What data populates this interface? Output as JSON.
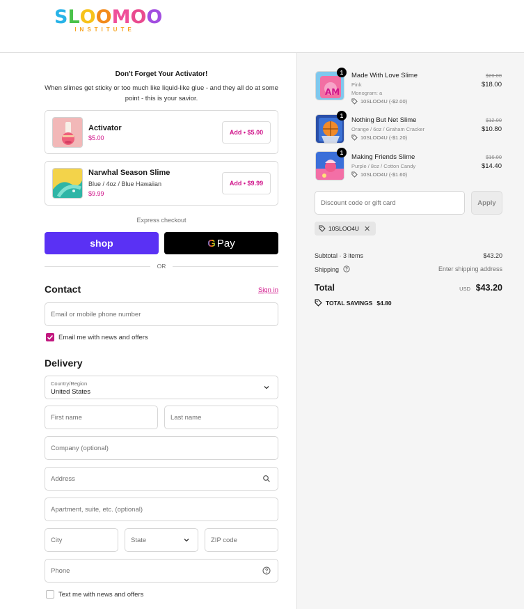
{
  "brand": {
    "name_letters": [
      "S",
      "L",
      "O",
      "O",
      "M",
      "O",
      "O"
    ],
    "name_colors": [
      "#28b3e8",
      "#4bc24b",
      "#f7c21b",
      "#f28a1b",
      "#ef4f9a",
      "#e94b8f",
      "#a24de0"
    ],
    "subtitle": "INSTITUTE"
  },
  "upsell": {
    "title": "Don't Forget Your Activator!",
    "description": "When slimes get sticky or too much like liquid-like glue - and they all do at some point - this is your savior.",
    "products": [
      {
        "name": "Activator",
        "variant": "",
        "price": "$5.00",
        "button": "Add • $5.00"
      },
      {
        "name": "Narwhal Season Slime",
        "variant": "Blue / 4oz / Blue Hawaiian",
        "price": "$9.99",
        "button": "Add • $9.99"
      }
    ]
  },
  "express": {
    "label": "Express checkout",
    "shop_label": "shop",
    "gpay_g": "G",
    "gpay_label": "Pay",
    "or_label": "OR"
  },
  "contact": {
    "title": "Contact",
    "signin": "Sign in",
    "email_placeholder": "Email or mobile phone number",
    "news_checkbox": "Email me with news and offers",
    "news_checked": true
  },
  "delivery": {
    "title": "Delivery",
    "country_label": "Country/Region",
    "country_value": "United States",
    "first_name": "First name",
    "last_name": "Last name",
    "company": "Company (optional)",
    "address": "Address",
    "apartment": "Apartment, suite, etc. (optional)",
    "city": "City",
    "state": "State",
    "zip": "ZIP code",
    "phone": "Phone",
    "text_checkbox": "Text me with news and offers",
    "text_checked": false
  },
  "summary": {
    "items": [
      {
        "qty": "1",
        "name": "Made With Love Slime",
        "variant": "Pink",
        "variant2": "Monogram: a",
        "discount": "10SLOO4U (-$2.00)",
        "old_price": "$20.00",
        "price": "$18.00"
      },
      {
        "qty": "1",
        "name": "Nothing But Net Slime",
        "variant": "Orange / 6oz / Graham Cracker",
        "discount": "10SLOO4U (-$1.20)",
        "old_price": "$12.00",
        "price": "$10.80"
      },
      {
        "qty": "1",
        "name": "Making Friends Slime",
        "variant": "Purple / 8oz / Cotton Candy",
        "discount": "10SLOO4U (-$1.60)",
        "old_price": "$16.00",
        "price": "$14.40"
      }
    ],
    "discount_placeholder": "Discount code or gift card",
    "apply": "Apply",
    "applied_code": "10SLOO4U",
    "subtotal_label": "Subtotal · 3 items",
    "subtotal_value": "$43.20",
    "shipping_label": "Shipping",
    "shipping_value": "Enter shipping address",
    "total_label": "Total",
    "currency": "USD",
    "total_value": "$43.20",
    "savings_label": "TOTAL SAVINGS",
    "savings_value": "$4.80"
  }
}
